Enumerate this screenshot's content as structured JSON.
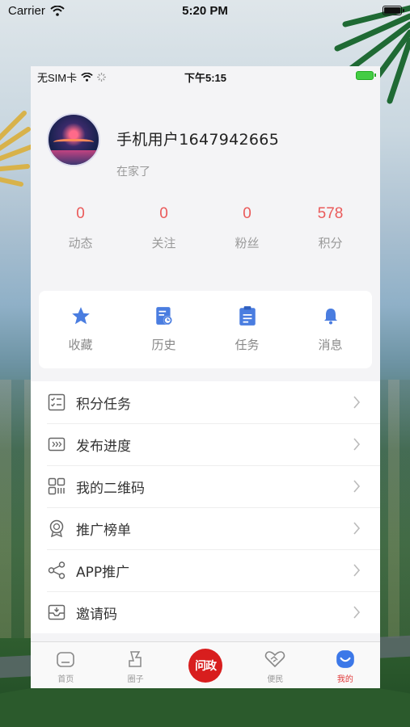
{
  "simulator_status": {
    "carrier": "Carrier",
    "time": "5:20 PM"
  },
  "phone_status": {
    "sim": "无SIM卡",
    "time": "下午5:15"
  },
  "profile": {
    "name": "手机用户1647942665",
    "signature": "在家了"
  },
  "stats": [
    {
      "value": "0",
      "label": "动态"
    },
    {
      "value": "0",
      "label": "关注"
    },
    {
      "value": "0",
      "label": "粉丝"
    },
    {
      "value": "578",
      "label": "积分"
    }
  ],
  "quick_actions": [
    {
      "label": "收藏",
      "icon": "star-icon"
    },
    {
      "label": "历史",
      "icon": "history-icon"
    },
    {
      "label": "任务",
      "icon": "clipboard-icon"
    },
    {
      "label": "消息",
      "icon": "bell-icon"
    }
  ],
  "menu": [
    {
      "label": "积分任务",
      "icon": "checklist-icon"
    },
    {
      "label": "发布进度",
      "icon": "progress-icon"
    },
    {
      "label": "我的二维码",
      "icon": "qrcode-icon"
    },
    {
      "label": "推广榜单",
      "icon": "badge-icon"
    },
    {
      "label": "APP推广",
      "icon": "share-icon"
    },
    {
      "label": "邀请码",
      "icon": "inbox-icon"
    }
  ],
  "tabbar": [
    {
      "label": "首页",
      "icon": "home-icon",
      "active": false
    },
    {
      "label": "圈子",
      "icon": "circle-icon",
      "active": false
    },
    {
      "label": "",
      "icon": "center-logo",
      "logo_text": "问政",
      "active": false
    },
    {
      "label": "便民",
      "icon": "handshake-icon",
      "active": false
    },
    {
      "label": "我的",
      "icon": "me-icon",
      "active": true
    }
  ],
  "colors": {
    "accent": "#e03a3a",
    "stat_number": "#ea5a5a",
    "icon_blue": "#4a7de0"
  }
}
